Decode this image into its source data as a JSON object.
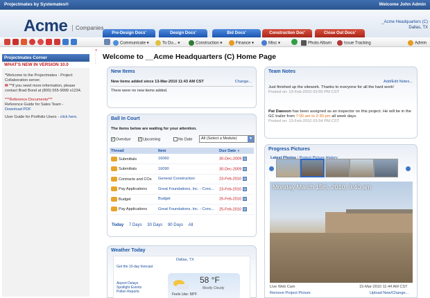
{
  "topbar": {
    "left": "Projectmates by Systemates®",
    "right": "Welcome John Admin"
  },
  "header": {
    "logo": "Acme",
    "logo_sub": "Companies",
    "location_line1": "_Acme Headquarters (C)",
    "location_line2": "Dallas, TX"
  },
  "tabs": [
    {
      "label": "Pre-Design Docs'",
      "color": "#1c56b0"
    },
    {
      "label": "Design Docs'",
      "color": "#1c56b0"
    },
    {
      "label": "Bid Docs'",
      "color": "#1c56b0"
    },
    {
      "label": "Construction Doc'",
      "color": "#a8261a"
    },
    {
      "label": "Close Out Docs'",
      "color": "#a8261a"
    }
  ],
  "toolbar": {
    "menus": [
      "Communicate ▾",
      "To Do... ▾",
      "Construction ▾",
      "Finance ▾",
      "Misc ▾"
    ],
    "photo_album": "Photo Album",
    "issue_tracking": "Issue Tracking",
    "admin": "Admin"
  },
  "sidebar": {
    "title": "Projectmates Corner",
    "whats_new": "WHAT'S NEW IN VERSION 10.0",
    "welcome": "*Welcome to the Projectmates - Project Collaboration server.",
    "help": "**If you need more information, please contact Brad Bond at (800) 555-9999 x1234.",
    "ref_title": "***Reference Documents***",
    "ref_sales": "Reference Guide for Sales Team -",
    "ref_download": "Download PDF",
    "ref_portfolio": "User Guide for Portfolio Users -",
    "ref_click": "click here."
  },
  "page_title": "Welcome to __Acme Headquarters (C) Home Page",
  "new_items": {
    "title": "New Items",
    "subtitle": "New items added since 13-Mar-2010 11:43 AM CST",
    "change": "Change...",
    "empty": "There were no new items added."
  },
  "ball": {
    "title": "Ball In Court",
    "subtitle": "The items below are waiting for your attention.",
    "overdue": "Overdue",
    "upcoming": "Upcoming",
    "no_date": "No Date",
    "module_select": "All (Select a Module)",
    "columns": [
      "Thread",
      "Item",
      "Due Date"
    ],
    "rows": [
      {
        "thread": "Submittals",
        "item": "16060",
        "due": "30-Dec-2009"
      },
      {
        "thread": "Submittals",
        "item": "16090",
        "due": "30-Dec-2009"
      },
      {
        "thread": "Contracts and COs",
        "item": "General Construction",
        "due": "23-Feb-2010"
      },
      {
        "thread": "Pay Applications",
        "item": "Great Foundations, Inc. - Conc...",
        "due": "23-Feb-2010"
      },
      {
        "thread": "Budget",
        "item": "Budget",
        "due": "25-Feb-2010"
      },
      {
        "thread": "Pay Applications",
        "item": "Great Foundations, Inc. - Conc...",
        "due": "25-Feb-2010"
      }
    ],
    "filters": [
      "Today",
      "7 Days",
      "30 Days",
      "90 Days",
      "All"
    ]
  },
  "weather": {
    "title": "Weather Today",
    "city": "Dallas, TX",
    "get_forecast": "Get the 10-day forecast",
    "airport": "Airport Delays",
    "spotlight": "Spotlight Events",
    "pollen": "Pollen Reports",
    "temp": "58 °F",
    "condition": "Mostly Cloudy",
    "feels": "Feels Like: 58°F"
  },
  "team_notes": {
    "title": "Team Notes",
    "add_edit": "Add/Edit Notes...",
    "note1": "Just finished up the sitework.  Thanks to everyone for all the hard work!",
    "note1_posted": "Posted on: 13-Feb-2010 03:55 PM CST",
    "note2_a": "Pat Dawson",
    "note2_b": " has been assigned as an inspector on this project. He will be in the GC trailer from ",
    "note2_time": "7:00 am to 2:30 pm",
    "note2_c": " all week days.",
    "note2_posted": "Posted on: 13-Feb-2010 03:54 PM CST"
  },
  "progress": {
    "title": "Progress Pictures",
    "latest": "Latest Photos",
    "history": "Project Picture History",
    "overlay": "Monday March 15th, 2010, 9:40 am",
    "cam": "Live Web Cam",
    "timestamp": "15-Mar-2010 11:44 AM CST",
    "remove": "Remove Project Picture",
    "upload": "Upload New/Change..."
  }
}
